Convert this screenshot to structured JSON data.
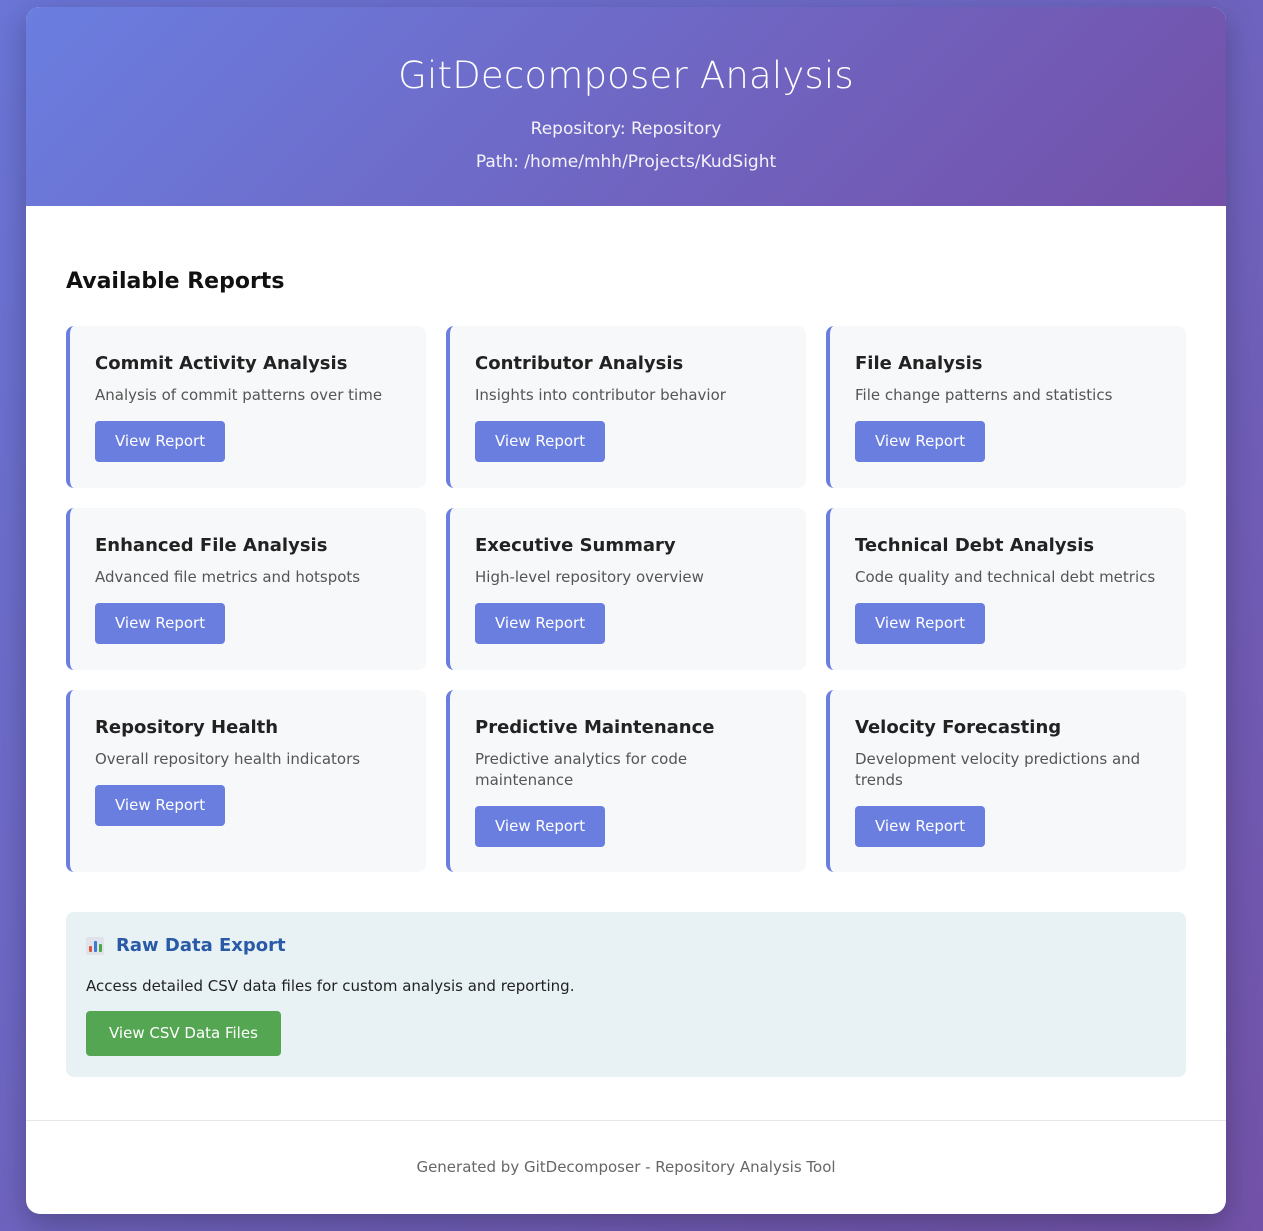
{
  "header": {
    "title": "GitDecomposer Analysis",
    "repository": "Repository: Repository",
    "path": "Path: /home/mhh/Projects/KudSight"
  },
  "main": {
    "section_title": "Available Reports",
    "reports": [
      {
        "title": "Commit Activity Analysis",
        "description": "Analysis of commit patterns over time",
        "button": "View Report"
      },
      {
        "title": "Contributor Analysis",
        "description": "Insights into contributor behavior",
        "button": "View Report"
      },
      {
        "title": "File Analysis",
        "description": "File change patterns and statistics",
        "button": "View Report"
      },
      {
        "title": "Enhanced File Analysis",
        "description": "Advanced file metrics and hotspots",
        "button": "View Report"
      },
      {
        "title": "Executive Summary",
        "description": "High-level repository overview",
        "button": "View Report"
      },
      {
        "title": "Technical Debt Analysis",
        "description": "Code quality and technical debt metrics",
        "button": "View Report"
      },
      {
        "title": "Repository Health",
        "description": "Overall repository health indicators",
        "button": "View Report"
      },
      {
        "title": "Predictive Maintenance",
        "description": "Predictive analytics for code maintenance",
        "button": "View Report"
      },
      {
        "title": "Velocity Forecasting",
        "description": "Development velocity predictions and trends",
        "button": "View Report"
      }
    ]
  },
  "export": {
    "icon": "bar-chart-icon",
    "title": "Raw Data Export",
    "description": "Access detailed CSV data files for custom analysis and reporting.",
    "button": "View CSV Data Files"
  },
  "footer": {
    "text": "Generated by GitDecomposer - Repository Analysis Tool"
  },
  "colors": {
    "accent": "#6a7ee0",
    "export_accent": "#2a5aa6",
    "success": "#55a653"
  }
}
